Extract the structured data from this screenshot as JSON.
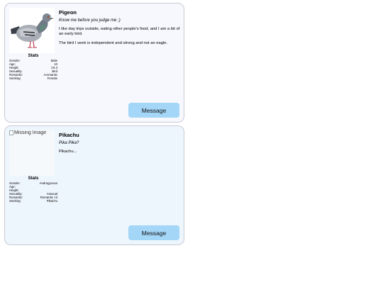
{
  "profiles": [
    {
      "name": "Pigeon",
      "tagline": "Know me before you judge me ;)",
      "bio": [
        "I like day trips outside, eating other people's food, and I am a bit of an early bird.",
        "The bird I seek is independent and strong and not an eagle."
      ],
      "stats_title": "Stats",
      "stats": [
        {
          "label": "Gender:",
          "value": "Male"
        },
        {
          "label": "Age:",
          "value": "10"
        },
        {
          "label": "Height:",
          "value": "1'6.3"
        },
        {
          "label": "Sexuality:",
          "value": "Bird"
        },
        {
          "label": "Romantic:",
          "value": "Aromantic"
        },
        {
          "label": "Seeking:",
          "value": "Female"
        }
      ],
      "button_label": "Message"
    },
    {
      "name": "Pikachu",
      "missing_image_text": "Missing Image",
      "tagline": "Pika Pika?",
      "bio": [
        "Pikachu..."
      ],
      "stats_title": "Stats",
      "stats": [
        {
          "label": "Gender:",
          "value": "Androgynous"
        },
        {
          "label": "Age:",
          "value": ""
        },
        {
          "label": "Height:",
          "value": ""
        },
        {
          "label": "Sexuality:",
          "value": "Asexual"
        },
        {
          "label": "Romantic:",
          "value": "Romantic <3"
        },
        {
          "label": "Seeking:",
          "value": "Pikachu"
        }
      ],
      "button_label": "Message"
    }
  ],
  "colors": {
    "card_1_bg": "#f7f8fe",
    "card_2_bg": "#eef6fd",
    "button_bg": "#a3d6f7",
    "border": "#c9c9d4"
  },
  "icons": {
    "profile_1_photo": "pigeon-photo",
    "profile_2_photo": "broken-image-icon"
  }
}
